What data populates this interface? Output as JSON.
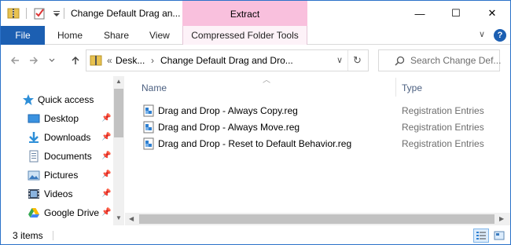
{
  "window": {
    "title": "Change Default Drag an...",
    "context_tab": "Extract",
    "controls": {
      "minimize": "—",
      "maximize": "☐",
      "close": "✕"
    }
  },
  "ribbon": {
    "file": "File",
    "tabs": [
      "Home",
      "Share",
      "View"
    ],
    "contextual_tab": "Compressed Folder Tools",
    "expand_icon": "∨",
    "help": "?"
  },
  "address": {
    "overflow": "«",
    "segments": [
      "Desk...",
      "Change Default Drag and Dro..."
    ],
    "separator": "›",
    "dropdown": "∨",
    "refresh": "↻"
  },
  "search": {
    "placeholder": "Search Change Def..."
  },
  "nav": {
    "quick_access": "Quick access",
    "items": [
      {
        "label": "Desktop",
        "icon": "desktop-icon",
        "pinned": true
      },
      {
        "label": "Downloads",
        "icon": "downloads-icon",
        "pinned": true
      },
      {
        "label": "Documents",
        "icon": "documents-icon",
        "pinned": true
      },
      {
        "label": "Pictures",
        "icon": "pictures-icon",
        "pinned": true
      },
      {
        "label": "Videos",
        "icon": "videos-icon",
        "pinned": true
      },
      {
        "label": "Google Drive",
        "icon": "google-drive-icon",
        "pinned": true
      }
    ]
  },
  "content": {
    "columns": {
      "name": "Name",
      "type": "Type"
    },
    "files": [
      {
        "name": "Drag and Drop - Always Copy.reg",
        "type": "Registration Entries"
      },
      {
        "name": "Drag and Drop - Always Move.reg",
        "type": "Registration Entries"
      },
      {
        "name": "Drag and Drop - Reset to Default Behavior.reg",
        "type": "Registration Entries"
      }
    ]
  },
  "status": {
    "item_count": "3 items"
  },
  "colors": {
    "accent": "#1c5fb2",
    "extract_tab": "#f9c0dd",
    "folder": "#e8c250"
  }
}
